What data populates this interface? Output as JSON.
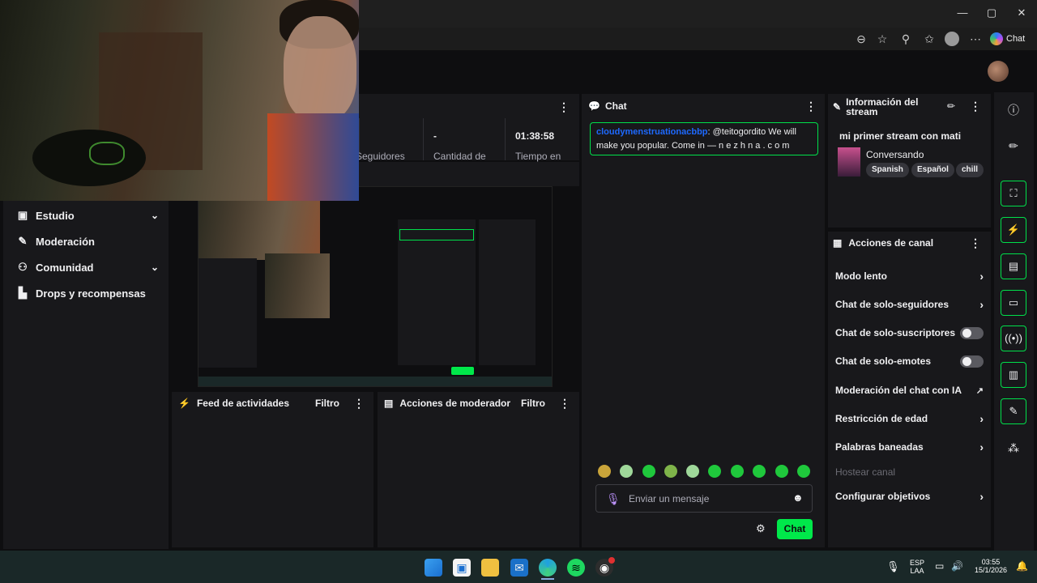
{
  "browser": {
    "window_controls": {
      "minimize": "—",
      "maximize": "▢",
      "close": "✕"
    },
    "copilot_label": "Chat"
  },
  "nav": {
    "items": [
      {
        "label": "Estudio",
        "icon": "video-icon",
        "glyph": "▣",
        "expandable": true
      },
      {
        "label": "Moderación",
        "icon": "wrench-icon",
        "glyph": "🔧",
        "expandable": false
      },
      {
        "label": "Comunidad",
        "icon": "people-icon",
        "glyph": "👥",
        "expandable": true
      },
      {
        "label": "Drops y recompensas",
        "icon": "chart-icon",
        "glyph": "▙",
        "expandable": false
      }
    ]
  },
  "stats": {
    "followers_label": "Seguidores",
    "views_value": "-",
    "views_label": "Cantidad de",
    "time_value": "01:38:58",
    "time_label": "Tiempo en"
  },
  "feed": {
    "title": "Feed de actividades",
    "filter": "Filtro"
  },
  "mod_actions": {
    "title": "Acciones de moderador",
    "filter": "Filtro"
  },
  "chat": {
    "title": "Chat",
    "message": {
      "user": "cloudymenstruationacbbp",
      "text": ": @teitogordito We will make you popular. Come in — n e z h n a . c o m"
    },
    "input_placeholder": "Enviar un mensaje",
    "send_label": "Chat"
  },
  "stream_info": {
    "title": "Información del stream",
    "stream_title": "mi primer stream con mati",
    "category": "Conversando",
    "tags": [
      "Spanish",
      "Español",
      "chill"
    ]
  },
  "channel_actions": {
    "title": "Acciones de canal",
    "items": [
      {
        "label": "Modo lento",
        "control": "chevron"
      },
      {
        "label": "Chat de solo-seguidores",
        "control": "chevron"
      },
      {
        "label": "Chat de solo-suscriptores",
        "control": "toggle"
      },
      {
        "label": "Chat de solo-emotes",
        "control": "toggle"
      },
      {
        "label": "Moderación del chat con IA",
        "control": "external"
      },
      {
        "label": "Restricción de edad",
        "control": "chevron"
      },
      {
        "label": "Palabras baneadas",
        "control": "chevron"
      },
      {
        "label": "Hostear canal",
        "control": "none",
        "disabled": true
      },
      {
        "label": "Configurar objetivos",
        "control": "chevron"
      }
    ]
  },
  "taskbar": {
    "language": "ESP",
    "language_sub": "LAA",
    "time": "03:55",
    "date": "15/1/2026"
  },
  "colors": {
    "accent_green": "#00e04b",
    "username_blue": "#1e69ff",
    "panel_bg": "#18181b",
    "page_bg": "#0e0e10"
  }
}
